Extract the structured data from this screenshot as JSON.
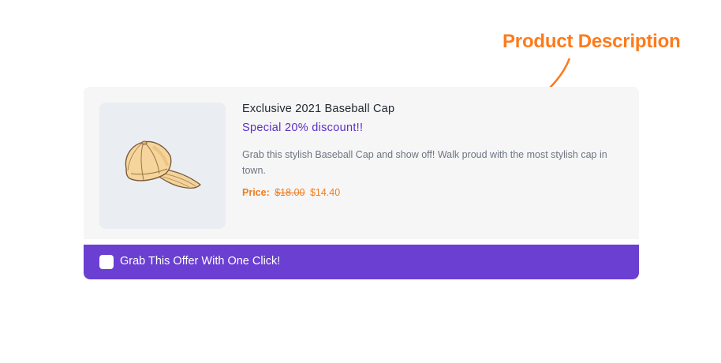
{
  "annotation": {
    "label": "Product Description",
    "color": "#ff7a1a"
  },
  "product": {
    "image_icon": "baseball-cap-image",
    "title": "Exclusive 2021 Baseball Cap",
    "discount": "Special 20% discount!!",
    "description": "Grab this stylish Baseball Cap and show off! Walk proud with the most stylish cap in town.",
    "price_label": "Price:",
    "original_price": "$18.00",
    "sale_price": "$14.40"
  },
  "offer": {
    "checkbox_checked": false,
    "label": "Grab This Offer With One Click!"
  },
  "colors": {
    "accent": "#6a3fd1",
    "discount_text": "#5d2fc4",
    "price": "#f07d1e",
    "card_background": "#f6f6f6",
    "thumb_background": "#eaeef3"
  }
}
